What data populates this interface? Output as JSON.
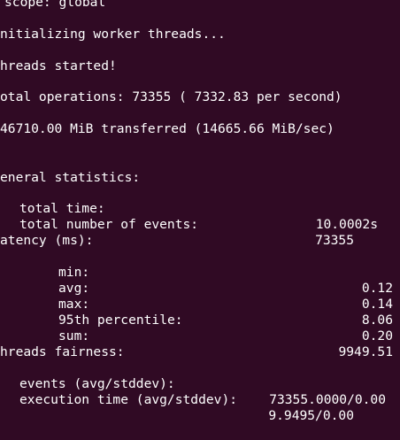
{
  "terminal": {
    "lines": {
      "scope": "scope: global",
      "init": "nitializing worker threads...",
      "started": "hreads started!",
      "total_ops": "otal operations: 73355 ( 7332.83 per second)",
      "transferred": "46710.00 MiB transferred (14665.66 MiB/sec)",
      "general_header": "eneral statistics:",
      "latency_header": "atency (ms):",
      "fairness_header": "hreads fairness:"
    },
    "general": [
      {
        "key": "total time:",
        "value": "10.0002s"
      },
      {
        "key": "total number of events:",
        "value": "73355"
      }
    ],
    "latency": [
      {
        "key": "min:",
        "value": "0.12"
      },
      {
        "key": "avg:",
        "value": "0.14"
      },
      {
        "key": "max:",
        "value": "8.06"
      },
      {
        "key": "95th percentile:",
        "value": "0.20"
      },
      {
        "key": "sum:",
        "value": "9949.51"
      }
    ],
    "fairness": [
      {
        "key": "events (avg/stddev):",
        "value": "73355.0000/0.00"
      },
      {
        "key": "execution time (avg/stddev):",
        "value": "9.9495/0.00"
      }
    ]
  }
}
